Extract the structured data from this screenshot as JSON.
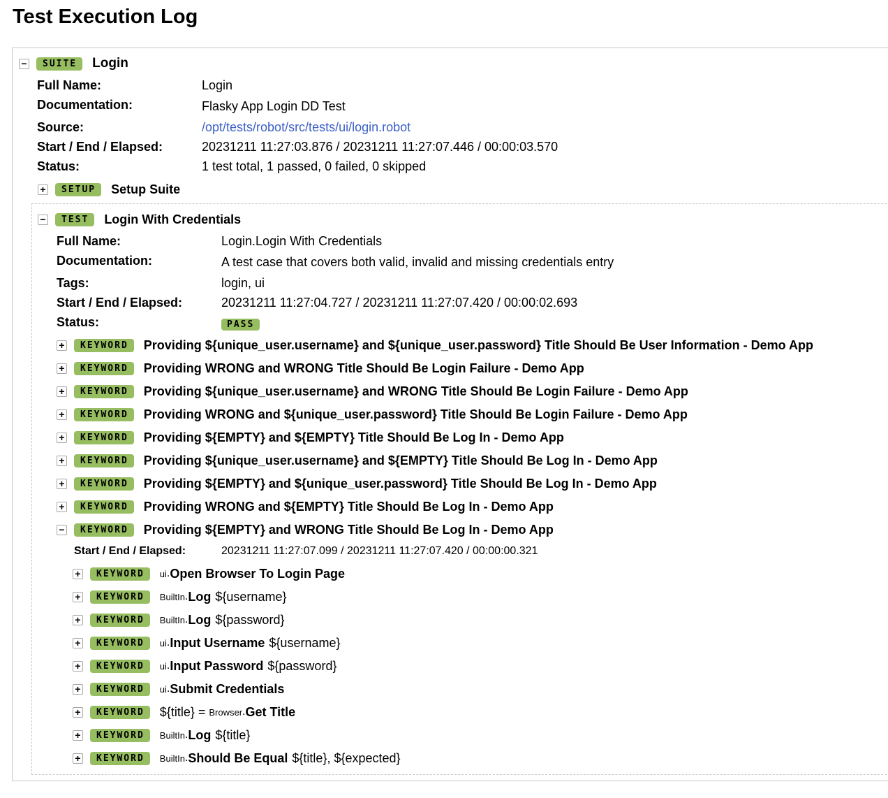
{
  "page": {
    "title": "Test Execution Log"
  },
  "suite": {
    "type": "SUITE",
    "name": "Login",
    "labels": {
      "full_name": "Full Name:",
      "documentation": "Documentation:",
      "source": "Source:",
      "times": "Start / End / Elapsed:",
      "status": "Status:"
    },
    "full_name": "Login",
    "documentation": "Flasky App Login DD Test",
    "source": "/opt/tests/robot/src/tests/ui/login.robot",
    "times": "20231211 11:27:03.876 / 20231211 11:27:07.446 / 00:00:03.570",
    "status": "1 test total, 1 passed, 0 failed, 0 skipped",
    "setup": {
      "type": "SETUP",
      "name": "Setup Suite"
    }
  },
  "test": {
    "type": "TEST",
    "name": "Login With Credentials",
    "labels": {
      "full_name": "Full Name:",
      "documentation": "Documentation:",
      "tags": "Tags:",
      "times": "Start / End / Elapsed:",
      "status": "Status:"
    },
    "full_name": "Login.Login With Credentials",
    "documentation": "A test case that covers both valid, invalid and missing credentials entry",
    "tags": "login, ui",
    "times": "20231211 11:27:04.727 / 20231211 11:27:07.420 / 00:00:02.693",
    "status_badge": "PASS",
    "status_color": "#97bd61"
  },
  "keyword_badge": "KEYWORD",
  "toggles": {
    "expand": "+",
    "collapse": "−"
  },
  "keywords": [
    "Providing ${unique_user.username} and ${unique_user.password} Title Should Be User Information - Demo App",
    "Providing WRONG and WRONG Title Should Be Login Failure - Demo App",
    "Providing ${unique_user.username} and WRONG Title Should Be Login Failure - Demo App",
    "Providing WRONG and ${unique_user.password} Title Should Be Login Failure - Demo App",
    "Providing ${EMPTY} and ${EMPTY} Title Should Be Log In - Demo App",
    "Providing ${unique_user.username} and ${EMPTY} Title Should Be Log In - Demo App",
    "Providing ${EMPTY} and ${unique_user.password} Title Should Be Log In - Demo App",
    "Providing WRONG and ${EMPTY} Title Should Be Log In - Demo App",
    "Providing ${EMPTY} and WRONG Title Should Be Log In - Demo App"
  ],
  "expanded_keyword": {
    "times_label": "Start / End / Elapsed:",
    "times": "20231211 11:27:07.099 / 20231211 11:27:07.420 / 00:00:00.321",
    "steps": [
      {
        "assign": "",
        "lib": "ui",
        "name": "Open Browser To Login Page",
        "args": ""
      },
      {
        "assign": "",
        "lib": "BuiltIn",
        "name": "Log",
        "args": "${username}"
      },
      {
        "assign": "",
        "lib": "BuiltIn",
        "name": "Log",
        "args": "${password}"
      },
      {
        "assign": "",
        "lib": "ui",
        "name": "Input Username",
        "args": "${username}"
      },
      {
        "assign": "",
        "lib": "ui",
        "name": "Input Password",
        "args": "${password}"
      },
      {
        "assign": "",
        "lib": "ui",
        "name": "Submit Credentials",
        "args": ""
      },
      {
        "assign": "${title} = ",
        "lib": "Browser",
        "name": "Get Title",
        "args": ""
      },
      {
        "assign": "",
        "lib": "BuiltIn",
        "name": "Log",
        "args": "${title}"
      },
      {
        "assign": "",
        "lib": "BuiltIn",
        "name": "Should Be Equal",
        "args": "${title}, ${expected}"
      }
    ]
  }
}
